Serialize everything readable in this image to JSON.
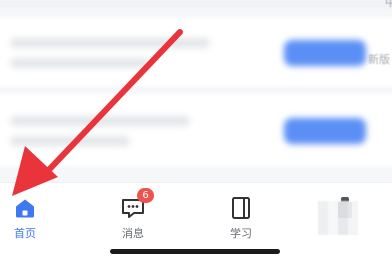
{
  "content": {
    "edge_text_top": "中",
    "edge_text_mid": "新版"
  },
  "tabbar": {
    "items": [
      {
        "label": "首页",
        "icon": "home-icon",
        "active": true
      },
      {
        "label": "消息",
        "icon": "message-icon",
        "badge": "6"
      },
      {
        "label": "学习",
        "icon": "notebook-icon"
      },
      {
        "label": "",
        "icon": "profile-icon"
      }
    ]
  },
  "colors": {
    "accent": "#3f79f0",
    "badge": "#ef5350",
    "annotation_arrow": "#e8343a"
  }
}
